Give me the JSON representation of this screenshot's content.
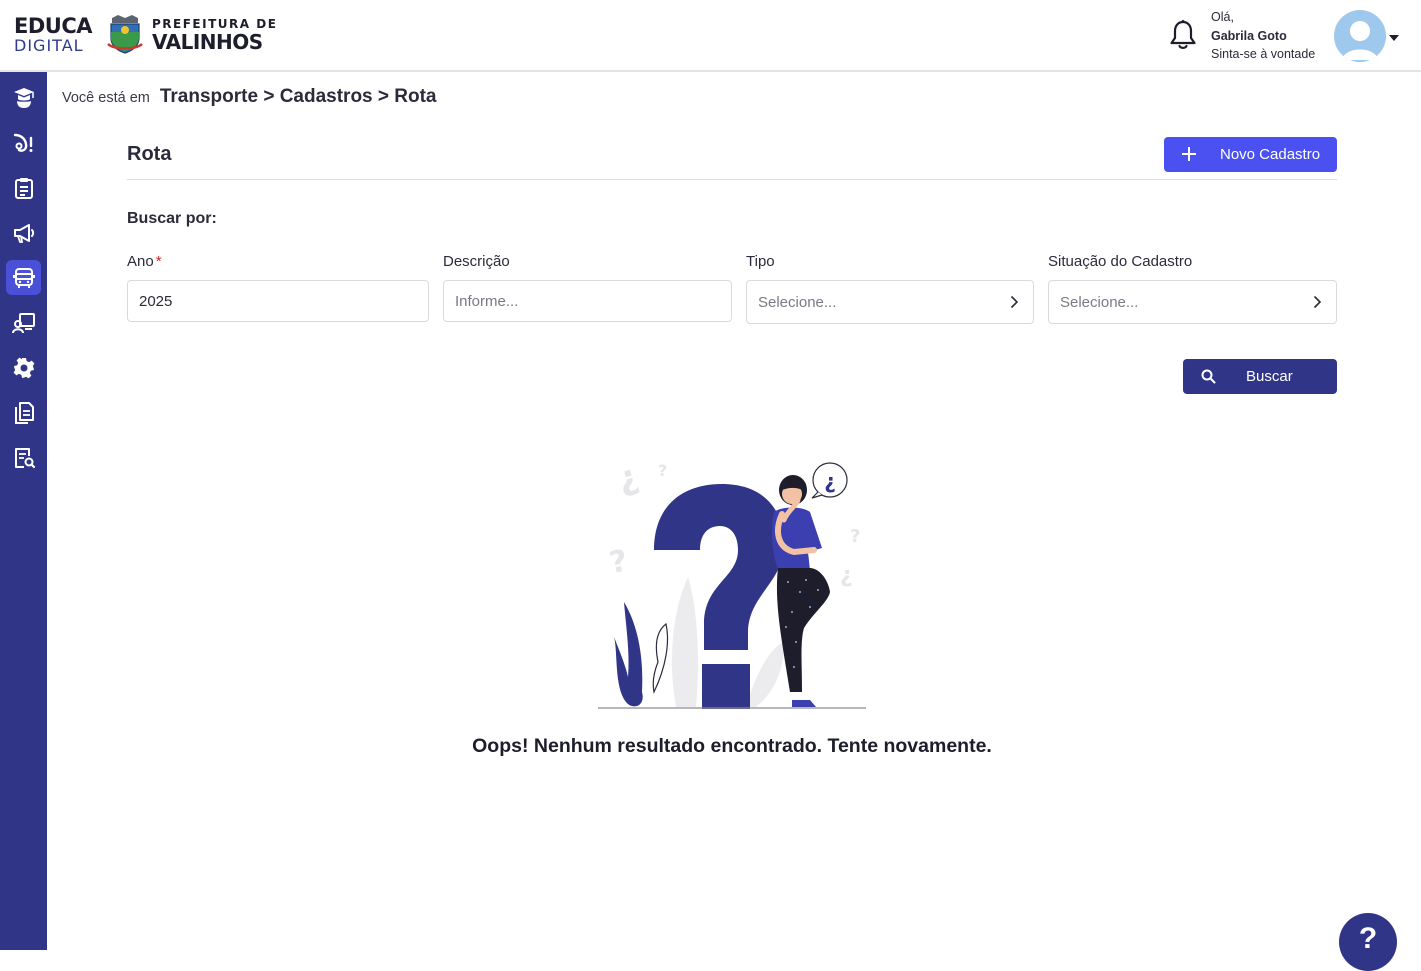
{
  "header": {
    "brand_top": "EDUCA",
    "brand_bottom": "DIGITAL",
    "prefeitura_top": "PREFEITURA DE",
    "prefeitura_bottom": "VALINHOS",
    "greeting": "Olá,",
    "user_name": "Gabrila Goto",
    "welcome": "Sinta-se à vontade",
    "icons": [
      "crest-icon",
      "bell-icon",
      "avatar-icon",
      "chevron-down-icon"
    ]
  },
  "sidebar": {
    "items": [
      {
        "name": "graduation-icon",
        "active": false
      },
      {
        "name": "music-icon",
        "active": false
      },
      {
        "name": "clipboard-icon",
        "active": false
      },
      {
        "name": "megaphone-icon",
        "active": false
      },
      {
        "name": "bus-icon",
        "active": true
      },
      {
        "name": "teacher-board-icon",
        "active": false
      },
      {
        "name": "gear-icon",
        "active": false
      },
      {
        "name": "documents-icon",
        "active": false
      },
      {
        "name": "document-search-icon",
        "active": false
      }
    ]
  },
  "breadcrumb": {
    "prefix": "Você está em",
    "path": "Transporte > Cadastros > Rota"
  },
  "page": {
    "title": "Rota",
    "new_button": "Novo Cadastro"
  },
  "filters": {
    "heading": "Buscar por:",
    "ano": {
      "label": "Ano",
      "required_mark": "*",
      "value": "2025"
    },
    "descricao": {
      "label": "Descrição",
      "placeholder": "Informe..."
    },
    "tipo": {
      "label": "Tipo",
      "placeholder": "Selecione..."
    },
    "situacao": {
      "label": "Situação do Cadastro",
      "placeholder": "Selecione..."
    },
    "search_button": "Buscar"
  },
  "empty_state": {
    "bubble": "¿",
    "message": "Oops! Nenhum resultado encontrado. Tente novamente."
  },
  "help": {
    "label": "?"
  },
  "colors": {
    "sidebar": "#303588",
    "active_item": "#4b51d6",
    "primary_button": "#4b51f0",
    "search_button": "#303588",
    "required": "#e02020"
  }
}
